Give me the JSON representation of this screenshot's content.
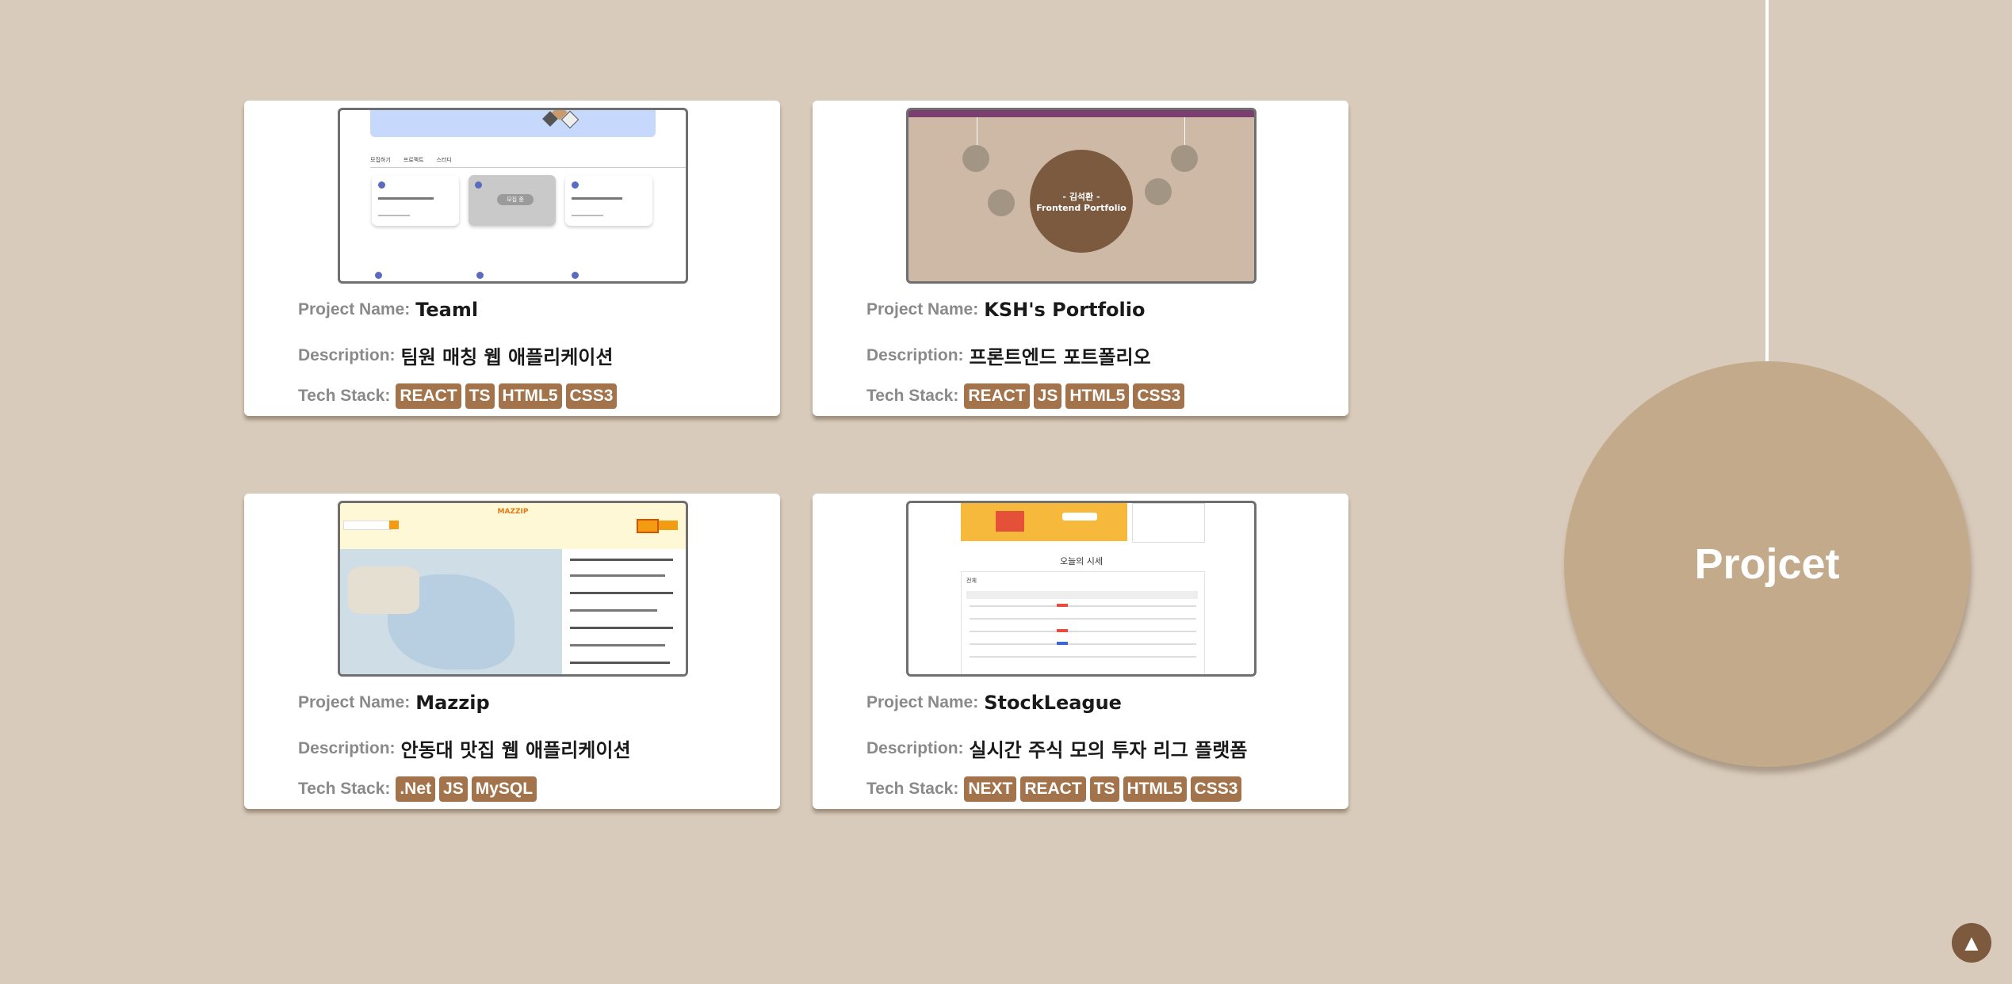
{
  "labels": {
    "name": "Project Name:",
    "description": "Description:",
    "tech": "Tech Stack:"
  },
  "projects": [
    {
      "name": "Teaml",
      "description": "팀원 매칭 웹 애플리케이션",
      "tech": [
        "REACT",
        "TS",
        "HTML5",
        "CSS3"
      ],
      "preview": {
        "tabs": [
          "모집하기",
          "프로젝트",
          "스터디"
        ],
        "hover_text": "모집 중"
      }
    },
    {
      "name": "KSH's Portfolio",
      "description": "프론트엔드 포트폴리오",
      "tech": [
        "REACT",
        "JS",
        "HTML5",
        "CSS3"
      ],
      "preview": {
        "line1": "- 김석환 -",
        "line2": "Frontend Portfolio"
      }
    },
    {
      "name": "Mazzip",
      "description": "안동대 맛집 웹 애플리케이션",
      "tech": [
        ".Net",
        "JS",
        "MySQL"
      ],
      "preview": {
        "logo": "MAZZIP"
      }
    },
    {
      "name": "StockLeague",
      "description": "실시간 주식 모의 투자 리그 플랫폼",
      "tech": [
        "NEXT",
        "REACT",
        "TS",
        "HTML5",
        "CSS3"
      ],
      "preview": {
        "heading": "오늘의 시세",
        "tab": "전체"
      }
    }
  ],
  "section": {
    "title": "Projcet"
  },
  "scroll_top": {
    "icon": "up-triangle-icon",
    "glyph": "▲"
  },
  "colors": {
    "background": "#d9cbbb",
    "badge": "#a3744b",
    "circle": "#c3aa8b",
    "label": "#8a8a8a",
    "scroll_button": "#7d5a3d"
  }
}
